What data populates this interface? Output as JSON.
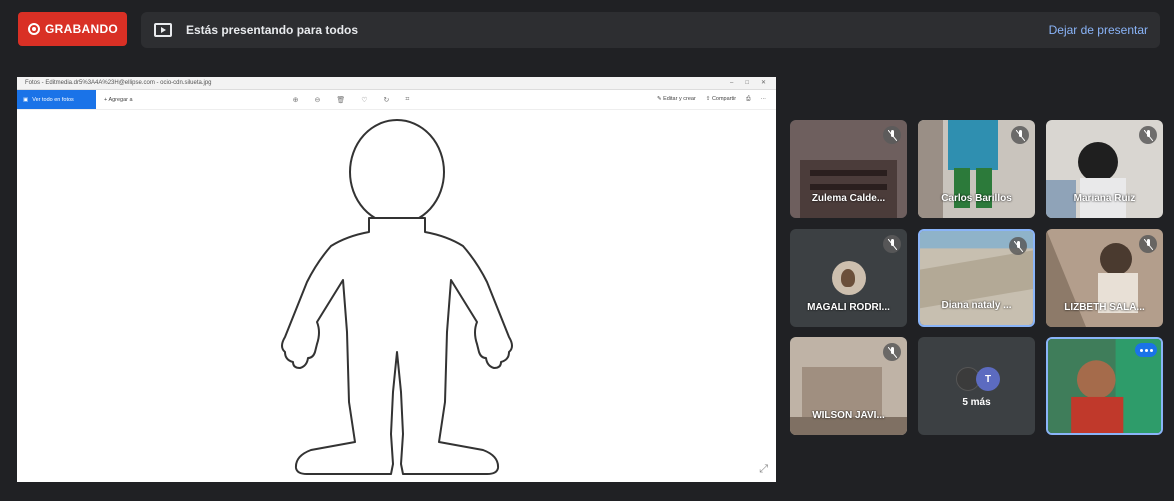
{
  "top_bar": {
    "recording_label": "GRABANDO",
    "presenting_text": "Estás presentando para todos",
    "stop_presenting_label": "Dejar de presentar"
  },
  "shared_screen": {
    "window_title": "Fotos - Editmedia.dr5%3A4A%23H@ellipse.com - ocio-cdn.silueta.jpg",
    "toolbar": {
      "primary_label": "Ver todo en fotos",
      "add_label": "Agregar a",
      "print_label": "Editar y crear",
      "share_label": "Compartir"
    }
  },
  "participants": [
    {
      "name": "Zulema Calde...",
      "muted": true
    },
    {
      "name": "Carlos Barillos",
      "muted": true
    },
    {
      "name": "Mariana Ruiz",
      "muted": true
    },
    {
      "name": "MAGALI RODRI...",
      "muted": true
    },
    {
      "name": "Diana nataly ...",
      "muted": true
    },
    {
      "name": "LIZBETH SALA...",
      "muted": true
    },
    {
      "name": "WILSON JAVI...",
      "muted": true
    }
  ],
  "more_tile": {
    "initial": "T",
    "label": "5 más"
  },
  "colors": {
    "recording": "#d93025",
    "accent": "#8ab4f8",
    "background": "#202124"
  }
}
